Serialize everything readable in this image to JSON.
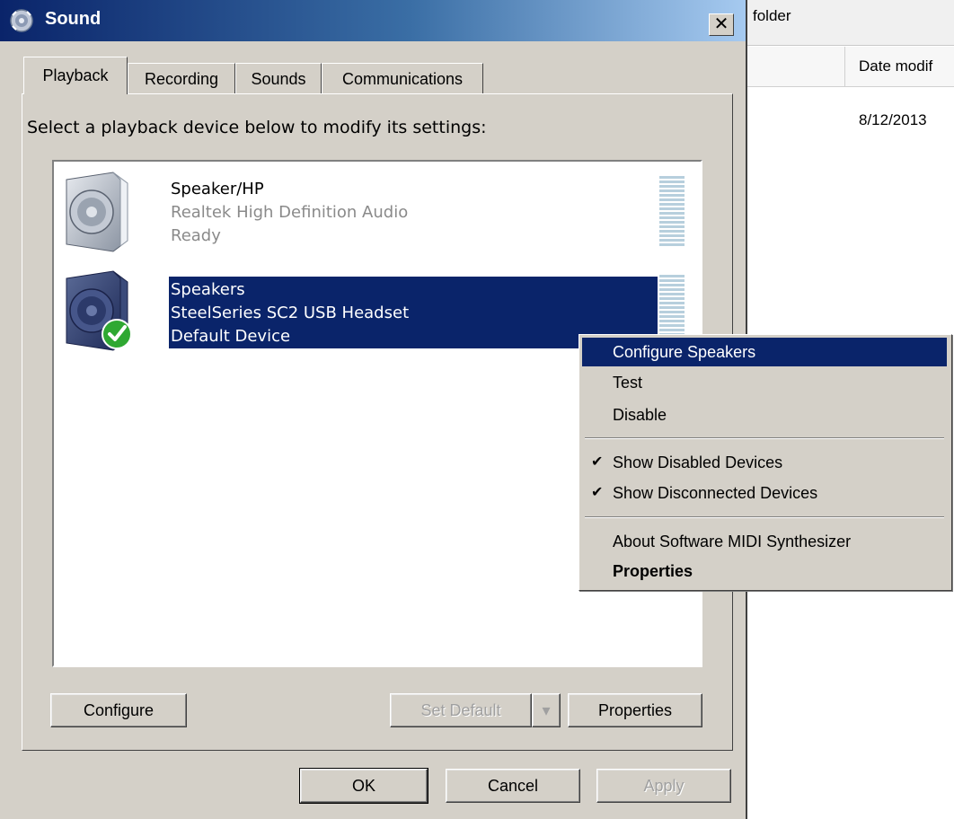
{
  "window": {
    "title": "Sound",
    "close_symbol": "✕"
  },
  "tabs": [
    {
      "label": "Playback",
      "active": true
    },
    {
      "label": "Recording",
      "active": false
    },
    {
      "label": "Sounds",
      "active": false
    },
    {
      "label": "Communications",
      "active": false
    }
  ],
  "instruction": "Select a playback device below to modify its settings:",
  "devices": [
    {
      "name": "Speaker/HP",
      "description": "Realtek High Definition Audio",
      "status": "Ready",
      "icon": "speaker-icon",
      "selected": false
    },
    {
      "name": "Speakers",
      "description": "SteelSeries SC2 USB Headset",
      "status": "Default Device",
      "icon": "speaker-default-icon",
      "selected": true
    }
  ],
  "buttons": {
    "configure": "Configure",
    "set_default": "Set Default",
    "set_default_arrow": "▾",
    "properties": "Properties",
    "ok": "OK",
    "cancel": "Cancel",
    "apply": "Apply"
  },
  "context_menu": {
    "items": [
      {
        "label": "Configure Speakers",
        "highlighted": true
      },
      {
        "label": "Test"
      },
      {
        "label": "Disable"
      },
      {
        "label": "Show Disabled Devices",
        "checked": true
      },
      {
        "label": "Show Disconnected Devices",
        "checked": true
      },
      {
        "label": "About Software MIDI Synthesizer"
      },
      {
        "label": "Properties",
        "bold": true
      }
    ],
    "check_symbol": "✔"
  },
  "background_window": {
    "folder_text": "folder",
    "column_date": "Date modif",
    "date_value": "8/12/2013"
  },
  "colors": {
    "selection": "#0a246a",
    "dialog_bg": "#d4d0c8",
    "title_gradient_start": "#0a246a",
    "title_gradient_end": "#a6caf0"
  }
}
